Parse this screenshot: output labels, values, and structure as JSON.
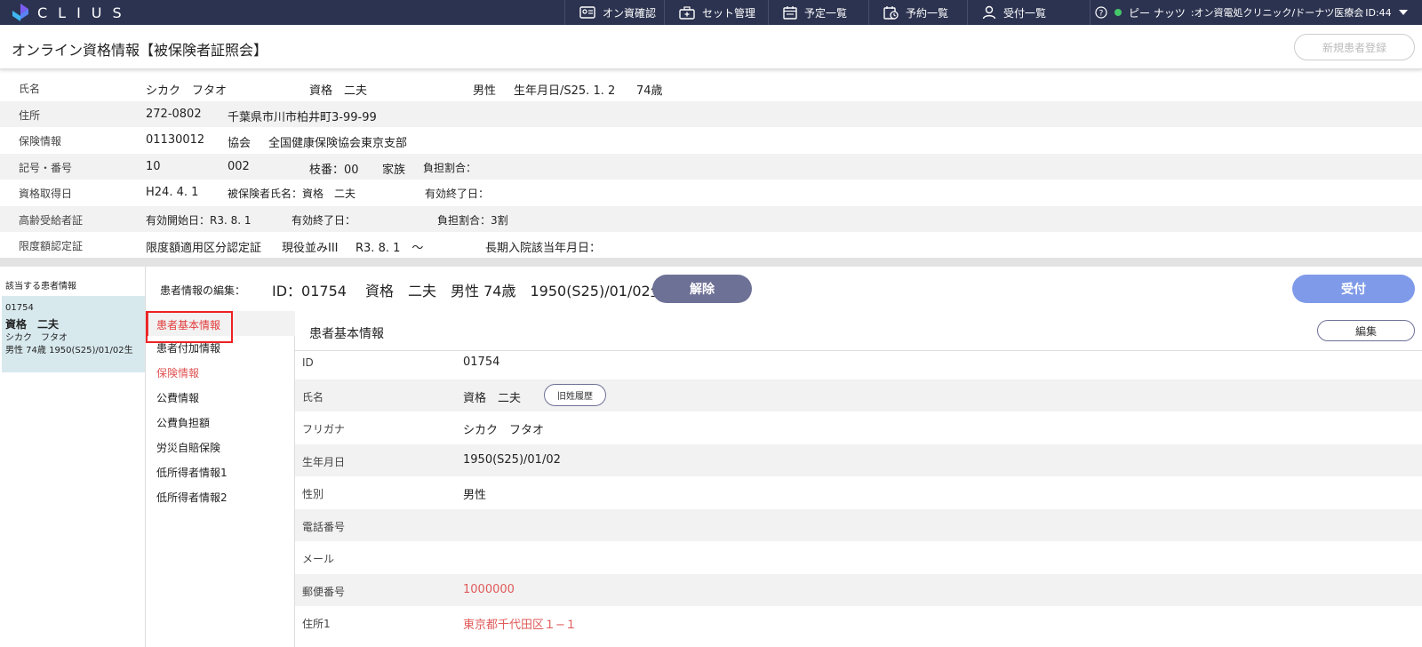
{
  "app": {
    "logo_text": "CLIUS"
  },
  "nav": {
    "items": [
      {
        "label": "オン資確認",
        "icon": "id-card-icon"
      },
      {
        "label": "セット管理",
        "icon": "briefcase-icon"
      },
      {
        "label": "予定一覧",
        "icon": "calendar-icon"
      },
      {
        "label": "予約一覧",
        "icon": "calendar-clock-icon"
      },
      {
        "label": "受付一覧",
        "icon": "user-icon"
      }
    ],
    "help_symbol": "?",
    "user_name": "ピー ナッツ",
    "user_org": ":オン資電処クリニック/ドーナツ医療会",
    "user_id": "ID:44",
    "status_color": "#45c76a"
  },
  "header": {
    "title": "オンライン資格情報【被保険者証照会】",
    "new_patient_button": "新規患者登録"
  },
  "online_info": {
    "name_label": "氏名",
    "kana": "シカク　フタオ",
    "name": "資格　二夫",
    "sex": "男性",
    "birth": "生年月日/S25. 1. 2",
    "age": "74歳",
    "address_label": "住所",
    "zip": "272-0802",
    "address": "千葉県市川市柏井町3-99-99",
    "insurance_label": "保険情報",
    "insurer_no": "01130012",
    "insurer_type": "協会",
    "insurer_name": "全国健康保険協会東京支部",
    "symbol_label": "記号・番号",
    "symbol": "10",
    "number": "002",
    "branch": "枝番：00",
    "relation": "家族",
    "burden": "負担割合：",
    "acquired_label": "資格取得日",
    "acquired_date": "H24. 4. 1",
    "insured_name": "被保険者氏名：資格　二夫",
    "valid_end": "有効終了日：",
    "elderly_label": "高齢受給者証",
    "elderly_start": "有効開始日：R3. 8. 1",
    "elderly_end": "有効終了日：",
    "elderly_burden": "負担割合：3割",
    "limit_label": "限度額認定証",
    "limit_cert": "限度額適用区分認定証",
    "limit_class": "現役並みIII",
    "limit_date": "R3. 8. 1　～",
    "long_stay": "長期入院該当年月日："
  },
  "patients": {
    "header": "該当する患者情報",
    "items": [
      {
        "id": "01754",
        "name": "資格　二夫",
        "kana": "シカク　フタオ",
        "desc": "男性 74歳 1950(S25)/01/02生"
      }
    ]
  },
  "edit": {
    "label": "患者情報の編集：",
    "patient": "ID：01754　 資格　二夫　男性 74歳　1950(S25)/01/02生",
    "release_button": "解除",
    "accept_button": "受付"
  },
  "submenu": {
    "items": [
      {
        "label": "患者基本情報"
      },
      {
        "label": "患者付加情報"
      },
      {
        "label": "保険情報"
      },
      {
        "label": "公費情報"
      },
      {
        "label": "公費負担額"
      },
      {
        "label": "労災自賠保険"
      },
      {
        "label": "低所得者情報1"
      },
      {
        "label": "低所得者情報2"
      }
    ]
  },
  "detail": {
    "title": "患者基本情報",
    "edit_button": "編集",
    "old_name_button": "旧姓履歴",
    "rows": [
      {
        "key": "ID",
        "value": "01754"
      },
      {
        "key": "氏名",
        "value": "資格　二夫"
      },
      {
        "key": "フリガナ",
        "value": "シカク　フタオ"
      },
      {
        "key": "生年月日",
        "value": "1950(S25)/01/02"
      },
      {
        "key": "性別",
        "value": "男性"
      },
      {
        "key": "電話番号",
        "value": ""
      },
      {
        "key": "メール",
        "value": ""
      },
      {
        "key": "郵便番号",
        "value": "1000000"
      },
      {
        "key": "住所1",
        "value": "東京都千代田区１−１"
      }
    ]
  }
}
